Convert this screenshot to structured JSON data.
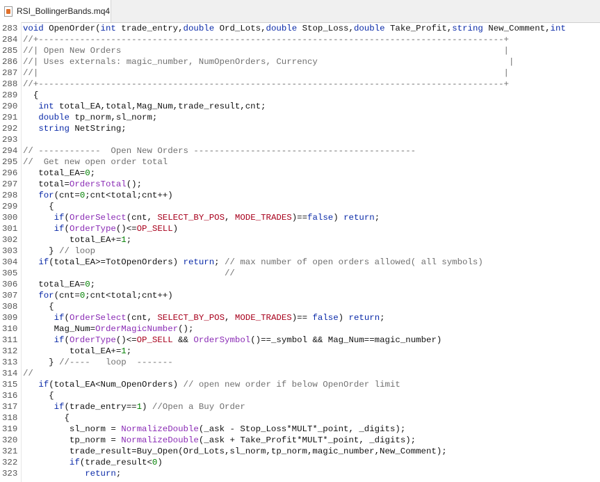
{
  "tab": {
    "title": "RSI_BollingerBands.mq4",
    "icon": "mq4-file-icon"
  },
  "colors": {
    "keyword": "#0a2aa8",
    "function": "#8a2bb5",
    "constant": "#a8001c",
    "comment": "#707070",
    "number": "#008000"
  },
  "lines": [
    {
      "n": "283",
      "t": "void OpenOrder(int trade_entry,double Ord_Lots,double Stop_Loss,double Take_Profit,string New_Comment,int"
    },
    {
      "n": "284",
      "t": "//+------------------------------------------------------------------------------------------+"
    },
    {
      "n": "285",
      "t": "//| Open New Orders                                                                          |"
    },
    {
      "n": "286",
      "t": "//| Uses externals: magic_number, NumOpenOrders, Currency                                     |"
    },
    {
      "n": "287",
      "t": "//|                                                                                          |"
    },
    {
      "n": "288",
      "t": "//+------------------------------------------------------------------------------------------+"
    },
    {
      "n": "289",
      "t": "  {"
    },
    {
      "n": "290",
      "t": "   int total_EA,total,Mag_Num,trade_result,cnt;"
    },
    {
      "n": "291",
      "t": "   double tp_norm,sl_norm;"
    },
    {
      "n": "292",
      "t": "   string NetString;"
    },
    {
      "n": "293",
      "t": ""
    },
    {
      "n": "294",
      "t": "// ------------  Open New Orders -------------------------------------------"
    },
    {
      "n": "295",
      "t": "//  Get new open order total"
    },
    {
      "n": "296",
      "t": "   total_EA=0;"
    },
    {
      "n": "297",
      "t": "   total=OrdersTotal();"
    },
    {
      "n": "298",
      "t": "   for(cnt=0;cnt<total;cnt++)"
    },
    {
      "n": "299",
      "t": "     {"
    },
    {
      "n": "300",
      "t": "      if(OrderSelect(cnt, SELECT_BY_POS, MODE_TRADES)==false) return;"
    },
    {
      "n": "301",
      "t": "      if(OrderType()<=OP_SELL)"
    },
    {
      "n": "302",
      "t": "         total_EA+=1;"
    },
    {
      "n": "303",
      "t": "     } // loop"
    },
    {
      "n": "304",
      "t": "   if(total_EA>=TotOpenOrders) return; // max number of open orders allowed( all symbols)"
    },
    {
      "n": "305",
      "t": "                                       //"
    },
    {
      "n": "306",
      "t": "   total_EA=0;"
    },
    {
      "n": "307",
      "t": "   for(cnt=0;cnt<total;cnt++)"
    },
    {
      "n": "308",
      "t": "     {"
    },
    {
      "n": "309",
      "t": "      if(OrderSelect(cnt, SELECT_BY_POS, MODE_TRADES)== false) return;"
    },
    {
      "n": "310",
      "t": "      Mag_Num=OrderMagicNumber();"
    },
    {
      "n": "311",
      "t": "      if(OrderType()<=OP_SELL && OrderSymbol()==_symbol && Mag_Num==magic_number)"
    },
    {
      "n": "312",
      "t": "         total_EA+=1;"
    },
    {
      "n": "313",
      "t": "     } //----   loop  -------"
    },
    {
      "n": "314",
      "t": "//"
    },
    {
      "n": "315",
      "t": "   if(total_EA<Num_OpenOrders) // open new order if below OpenOrder limit"
    },
    {
      "n": "316",
      "t": "     {"
    },
    {
      "n": "317",
      "t": "      if(trade_entry==1) //Open a Buy Order"
    },
    {
      "n": "318",
      "t": "        {"
    },
    {
      "n": "319",
      "t": "         sl_norm = NormalizeDouble(_ask - Stop_Loss*MULT*_point, _digits);"
    },
    {
      "n": "320",
      "t": "         tp_norm = NormalizeDouble(_ask + Take_Profit*MULT*_point, _digits);"
    },
    {
      "n": "321",
      "t": "         trade_result=Buy_Open(Ord_Lots,sl_norm,tp_norm,magic_number,New_Comment);"
    },
    {
      "n": "322",
      "t": "         if(trade_result<0)"
    },
    {
      "n": "323",
      "t": "            return;"
    }
  ]
}
